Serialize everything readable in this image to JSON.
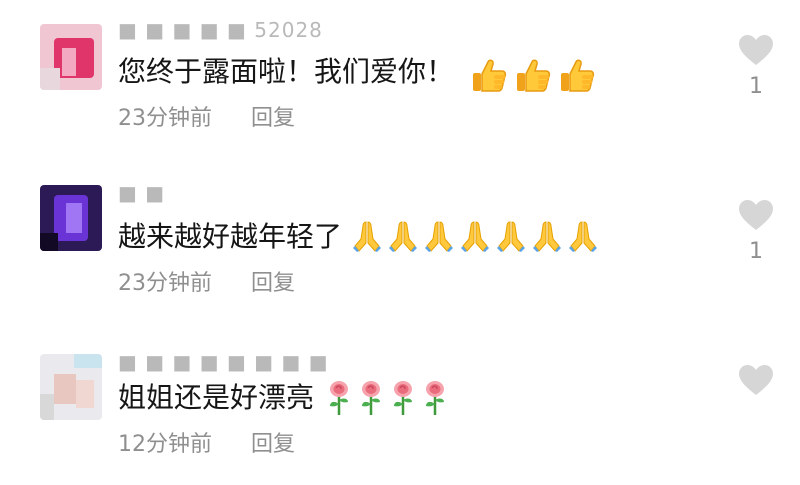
{
  "comments": [
    {
      "username": "■ ■ ■ ■ ■ 52028",
      "text": "您终于露面啦！我们爱你！",
      "emoji_icon": "thumbs-up-icon",
      "emoji_count": 3,
      "time": "23分钟前",
      "reply_label": "回复",
      "like_count": "1"
    },
    {
      "username": "■ ■",
      "text": "越来越好越年轻了",
      "emoji_icon": "praying-hands-icon",
      "emoji_count": 7,
      "time": "23分钟前",
      "reply_label": "回复",
      "like_count": "1"
    },
    {
      "username": "■ ■ ■ ■ ■ ■ ■ ■",
      "text": "姐姐还是好漂亮",
      "emoji_icon": "rose-icon",
      "emoji_count": 4,
      "time": "12分钟前",
      "reply_label": "回复",
      "like_count": ""
    }
  ],
  "colors": {
    "text": "#161616",
    "meta": "#8f8f8f",
    "heart": "#d6d6d6"
  }
}
